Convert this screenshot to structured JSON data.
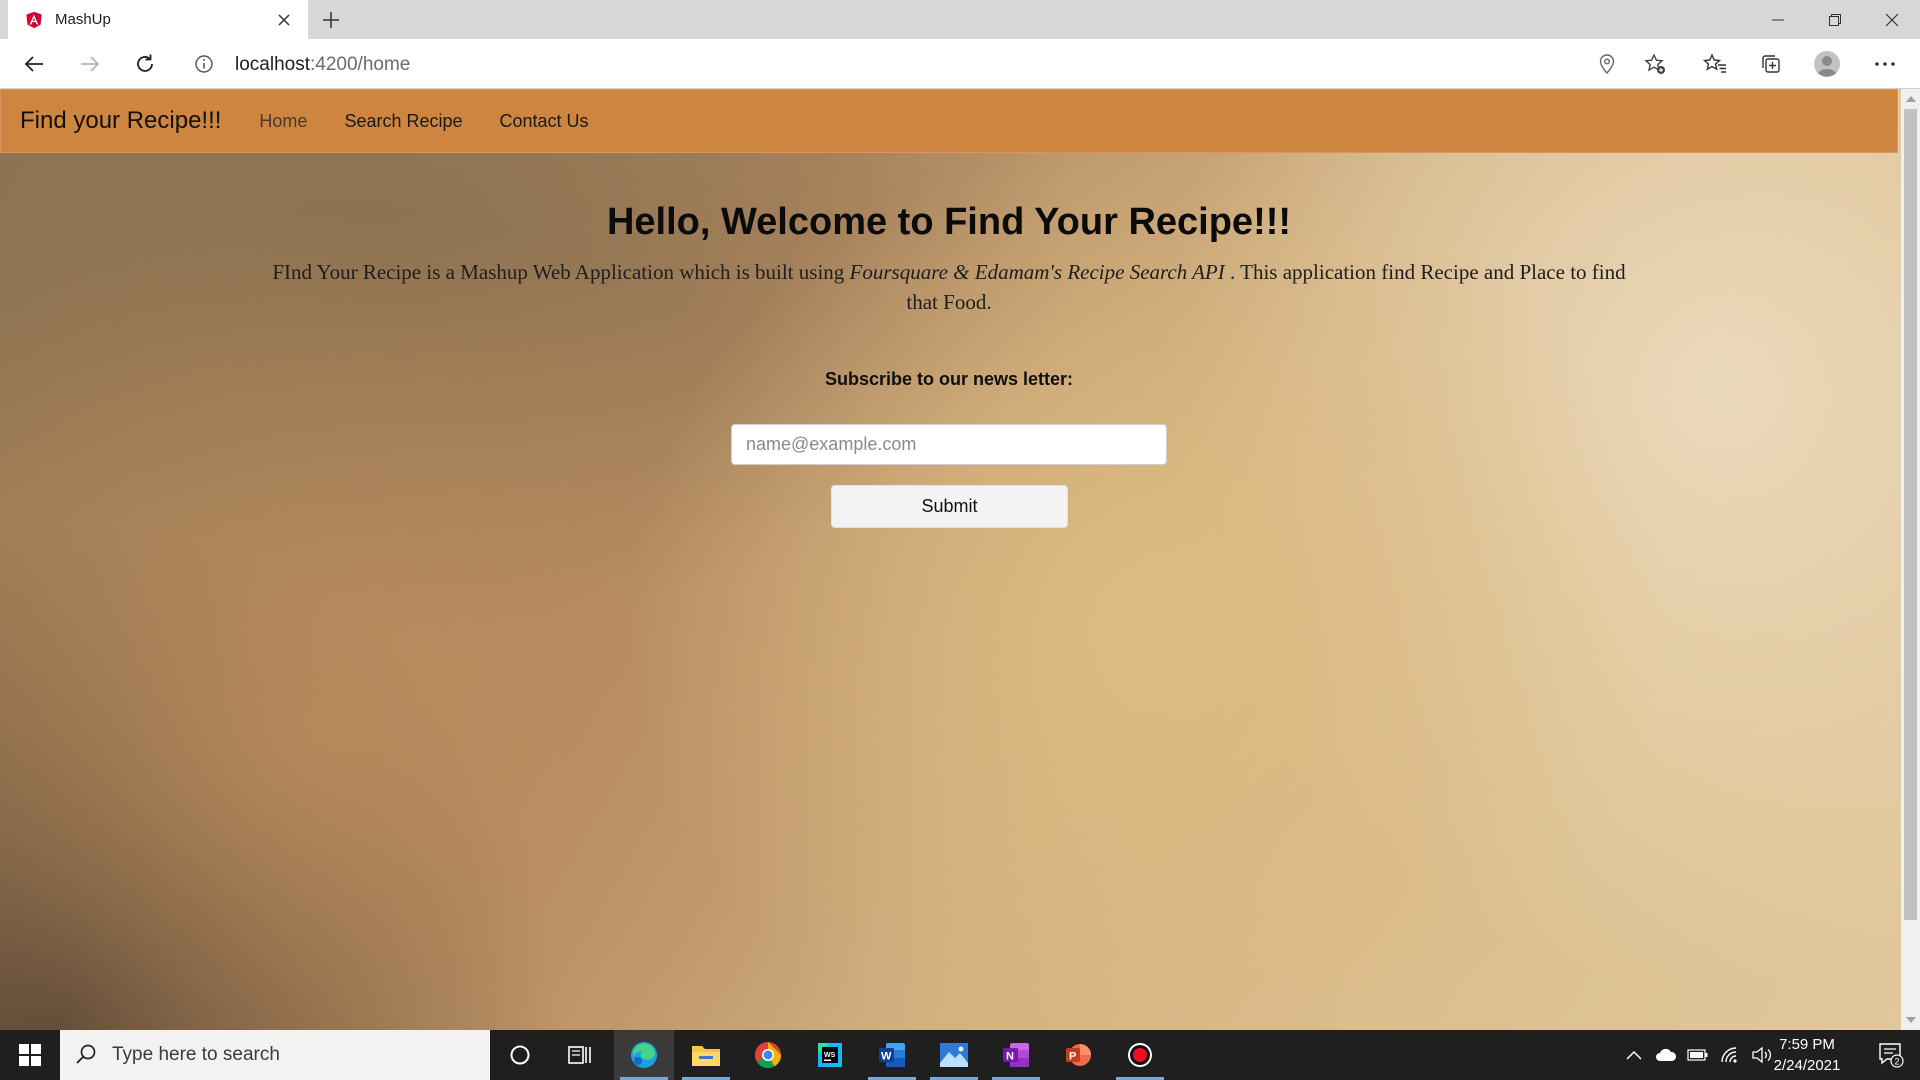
{
  "browser": {
    "tab_title": "MashUp",
    "url_host": "localhost",
    "url_rest": ":4200/home"
  },
  "page": {
    "brand": "Find your Recipe!!!",
    "nav": [
      {
        "label": "Home"
      },
      {
        "label": "Search Recipe"
      },
      {
        "label": "Contact Us"
      }
    ],
    "title": "Hello, Welcome to Find Your Recipe!!!",
    "desc_start": "FInd Your Recipe is a Mashup Web Application which is built using ",
    "desc_em": "Foursquare & Edamam's Recipe Search API",
    "desc_end": " . This application find Recipe and Place to find that Food.",
    "subscribe_label": "Subscribe to our news letter:",
    "email_placeholder": "name@example.com",
    "submit_label": "Submit"
  },
  "taskbar": {
    "search_placeholder": "Type here to search",
    "time": "7:59 PM",
    "date": "2/24/2021",
    "notification_count": "2"
  },
  "colors": {
    "navbar": "#cd853f",
    "taskbar": "#1f1f1f",
    "angular_red": "#dd0031"
  }
}
